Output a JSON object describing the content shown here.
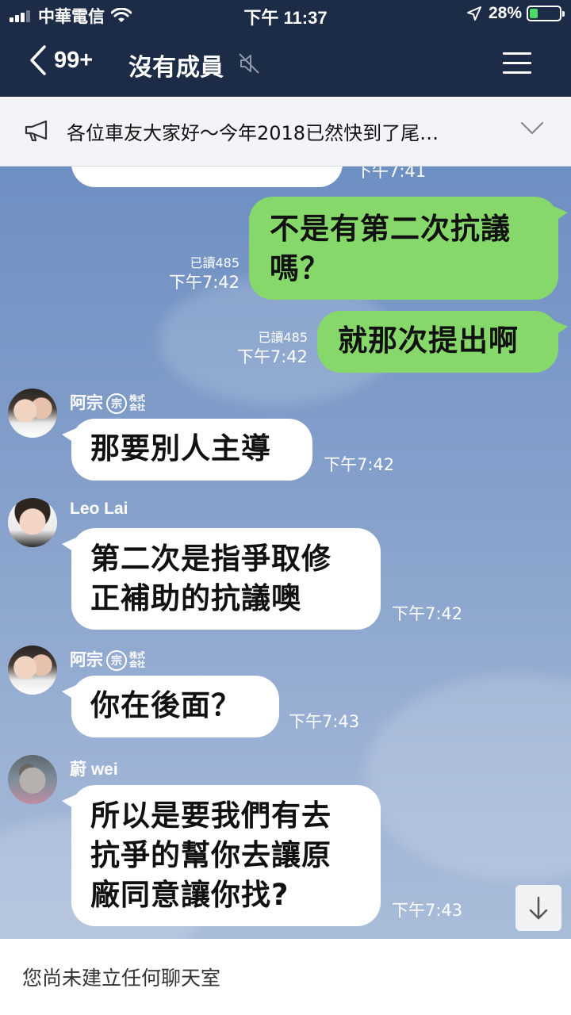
{
  "status_bar": {
    "carrier": "中華電信",
    "time": "下午 11:37",
    "battery": "28%",
    "battery_level": 0.28
  },
  "header": {
    "back_count": "99+",
    "title": "沒有成員",
    "icons": [
      "back-chevron-icon",
      "mute-icon",
      "menu-icon"
    ]
  },
  "announcement": {
    "text": "各位車友大家好～今年2018已然快到了尾…",
    "icons": [
      "megaphone-icon",
      "chevron-down-icon"
    ]
  },
  "messages": [
    {
      "id": "m0",
      "direction": "in",
      "text": "",
      "time": "下午7:41",
      "partial": true
    },
    {
      "id": "m1",
      "direction": "out",
      "lines": [
        "不是有第二次抗議",
        "嗎？"
      ],
      "read": "已讀485",
      "time": "下午7:42"
    },
    {
      "id": "m2",
      "direction": "out",
      "lines": [
        "就那次提出啊"
      ],
      "read": "已讀485",
      "time": "下午7:42"
    },
    {
      "id": "m3",
      "direction": "in",
      "sender": "阿宗",
      "sender_badge": "宗",
      "sender_badge2": "株式会社",
      "lines": [
        "那要別人主導"
      ],
      "time": "下午7:42"
    },
    {
      "id": "m4",
      "direction": "in",
      "sender": "Leo Lai",
      "lines": [
        "第二次是指爭取修",
        "正補助的抗議噢"
      ],
      "time": "下午7:42"
    },
    {
      "id": "m5",
      "direction": "in",
      "sender": "阿宗",
      "sender_badge": "宗",
      "sender_badge2": "株式会社",
      "lines": [
        "你在後面？"
      ],
      "time": "下午7:43"
    },
    {
      "id": "m6",
      "direction": "in",
      "sender": "蔚 wei",
      "lines": [
        "所以是要我們有去",
        "抗爭的幫你去讓原",
        "廠同意讓你找?"
      ],
      "time": "下午7:43"
    }
  ],
  "scroll_button": {
    "icon": "arrow-down-icon"
  },
  "bottom": {
    "text": "您尚未建立任何聊天室"
  },
  "colors": {
    "header_bg": "#1c2b46",
    "chat_bg": "#7d98c2",
    "outgoing_bubble": "#86d86a",
    "incoming_bubble": "#ffffff"
  }
}
